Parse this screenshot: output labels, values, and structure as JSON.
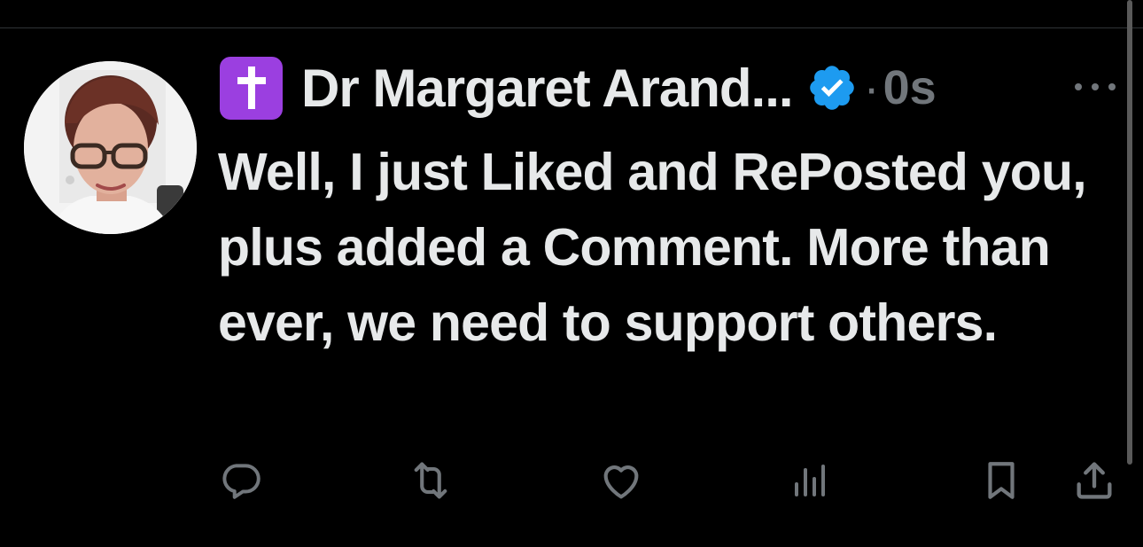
{
  "tweet": {
    "author_badge_icon": "latin-cross-icon",
    "author_badge_color": "#9b3fe0",
    "display_name": "Dr Margaret Arand...",
    "verified_icon": "verified-badge-icon",
    "verified_color": "#1d9bf0",
    "separator": "·",
    "timestamp": "0s",
    "more_icon": "more-options-icon",
    "text": "Well, I just Liked and RePosted you, plus added a Comment. More than ever, we need to support others."
  },
  "actions": [
    {
      "name": "reply",
      "icon": "reply-icon"
    },
    {
      "name": "repost",
      "icon": "repost-icon"
    },
    {
      "name": "like",
      "icon": "like-icon"
    },
    {
      "name": "views",
      "icon": "views-icon"
    },
    {
      "name": "bookmark",
      "icon": "bookmark-icon"
    },
    {
      "name": "share",
      "icon": "share-icon"
    }
  ],
  "colors": {
    "background": "#000000",
    "text": "#e7e9ea",
    "muted": "#71767b"
  }
}
